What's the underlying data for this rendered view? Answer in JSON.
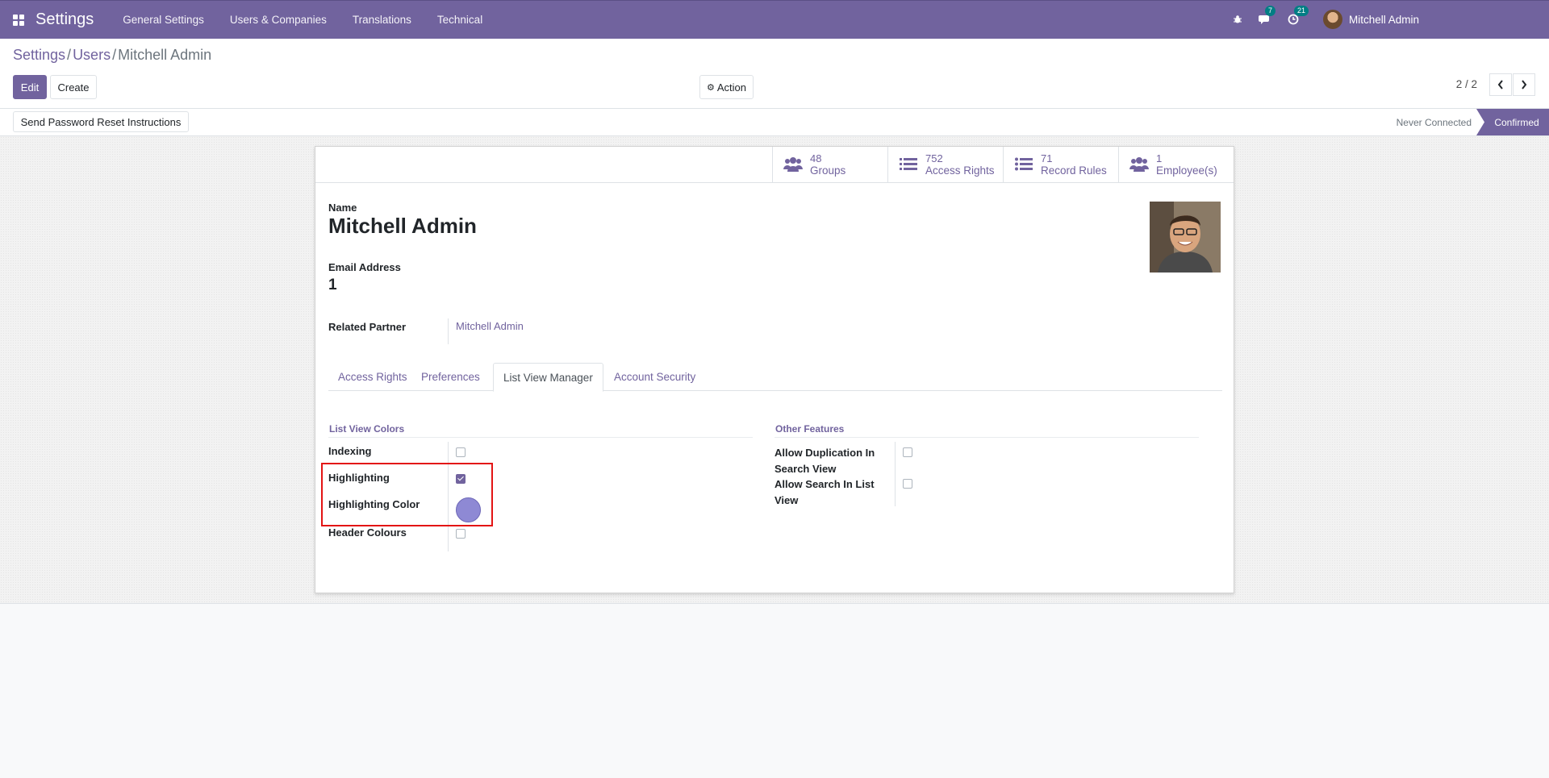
{
  "navbar": {
    "brand": "Settings",
    "menu": [
      "General Settings",
      "Users & Companies",
      "Translations",
      "Technical"
    ],
    "messages_count": "7",
    "activities_count": "21",
    "user_name": "Mitchell Admin"
  },
  "breadcrumb": {
    "settings": "Settings",
    "users": "Users",
    "current": "Mitchell Admin"
  },
  "toolbar": {
    "edit": "Edit",
    "create": "Create",
    "action": "Action",
    "pager": "2 / 2"
  },
  "statusbar": {
    "reset_button": "Send Password Reset Instructions",
    "stage_never": "Never Connected",
    "stage_confirmed": "Confirmed"
  },
  "stats": [
    {
      "num": "48",
      "label": "Groups",
      "icon": "users-icon"
    },
    {
      "num": "752",
      "label": "Access Rights",
      "icon": "list-icon"
    },
    {
      "num": "71",
      "label": "Record Rules",
      "icon": "list-icon"
    },
    {
      "num": "1",
      "label": "Employee(s)",
      "icon": "users-icon"
    }
  ],
  "form": {
    "name_label": "Name",
    "name_value": "Mitchell Admin",
    "email_label": "Email Address",
    "email_value": "1",
    "partner_label": "Related Partner",
    "partner_value": "Mitchell Admin"
  },
  "tabs": [
    "Access Rights",
    "Preferences",
    "List View Manager",
    "Account Security"
  ],
  "active_tab": "List View Manager",
  "list_view_colors": {
    "title": "List View Colors",
    "indexing": {
      "label": "Indexing",
      "checked": false
    },
    "highlighting": {
      "label": "Highlighting",
      "checked": true
    },
    "highlighting_color": {
      "label": "Highlighting Color",
      "color": "#8e89d4"
    },
    "header_colours": {
      "label": "Header Colours",
      "checked": false
    }
  },
  "other_features": {
    "title": "Other Features",
    "dup_line1": "Allow Duplication In",
    "dup_line2": "Search View",
    "search_line1": "Allow Search In List",
    "search_line2": "View"
  },
  "colors": {
    "primary": "#71639e",
    "annotation": "#e31414"
  }
}
